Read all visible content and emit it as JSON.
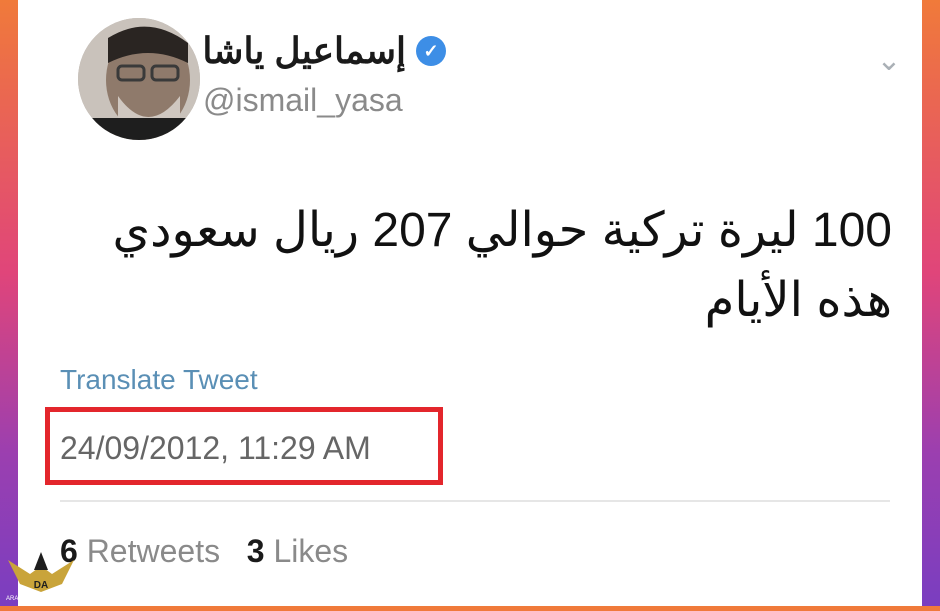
{
  "tweet": {
    "display_name": "إسماعيل ياشا",
    "verified_badge": "✓",
    "handle": "@ismail_yasa",
    "text": "100 ليرة تركية حوالي 207 ريال سعودي هذه الأيام",
    "translate_label": "Translate Tweet",
    "timestamp": "24/09/2012, 11:29 AM",
    "retweets_count": "6",
    "retweets_label": "Retweets",
    "likes_count": "3",
    "likes_label": "Likes",
    "menu_glyph": "⌄"
  },
  "watermark": {
    "title": "ARAB DEFENSE FORUM",
    "abbr": "DA"
  },
  "colors": {
    "highlight": "#e3262c",
    "link": "#5a8fb5",
    "verified": "#3d8ee6"
  }
}
